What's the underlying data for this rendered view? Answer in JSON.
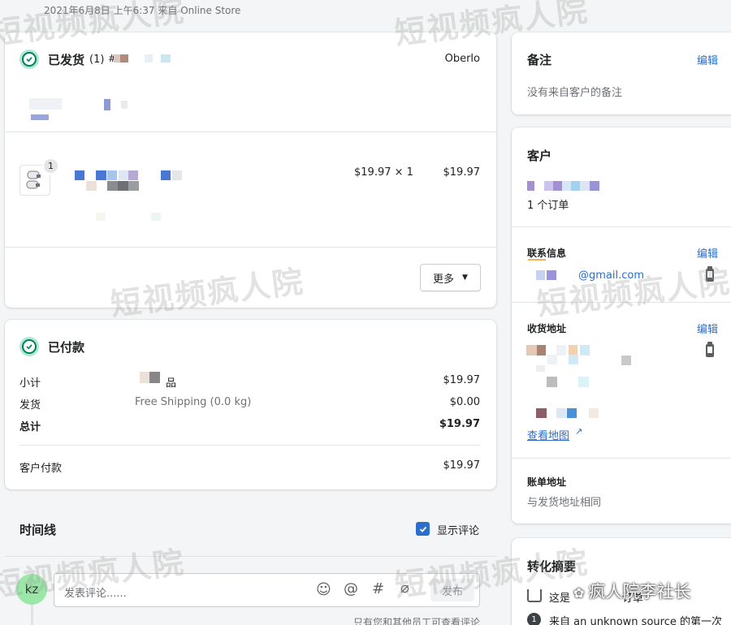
{
  "header": {
    "date_line": "2021年6月8日 上午6:37 来自 Online Store"
  },
  "fulfillment": {
    "title": "已发货",
    "count": "(1)",
    "hash": "#",
    "source": "Oberlo",
    "item_qty_badge": "1",
    "item_price": "$19.97 × 1",
    "item_total": "$19.97",
    "more_button": "更多"
  },
  "payment": {
    "title": "已付款",
    "rows": [
      {
        "label": "小计",
        "desc": "品",
        "amount": "$19.97"
      },
      {
        "label": "发货",
        "desc": "Free Shipping (0.0 kg)",
        "amount": "$0.00"
      },
      {
        "label": "总计",
        "desc": "",
        "amount": "$19.97"
      }
    ],
    "paid_label": "客户付款",
    "paid_amount": "$19.97"
  },
  "timeline": {
    "title": "时间线",
    "show_comments_label": "显示评论",
    "show_comments_checked": true,
    "avatar_initials": "kz",
    "comment_placeholder": "发表评论......",
    "post_button": "发布",
    "footer_note": "只有您和其他员工可查看评论"
  },
  "notes": {
    "title": "备注",
    "edit": "编辑",
    "empty_text": "没有来自客户的备注"
  },
  "customer": {
    "title": "客户",
    "orders_count": "1 个订单",
    "contact_title": "联系信息",
    "contact_edit": "编辑",
    "email_suffix": "@gmail.com",
    "shipping_title": "收货地址",
    "shipping_edit": "编辑",
    "view_map": "查看地图",
    "billing_title": "账单地址",
    "billing_text": "与发货地址相同"
  },
  "conversion": {
    "title": "转化摘要",
    "line1": "这是",
    "line1_tail": "订单",
    "line2": "来自 an unknown source 的第一次"
  },
  "watermarks": {
    "text": "短视频疯人院",
    "account": "疯人院李社长"
  },
  "colors": {
    "success": "#007f5f",
    "success_bg": "#aee9d1",
    "link": "#2c6ecb",
    "checkbox": "#2c6ecb"
  }
}
